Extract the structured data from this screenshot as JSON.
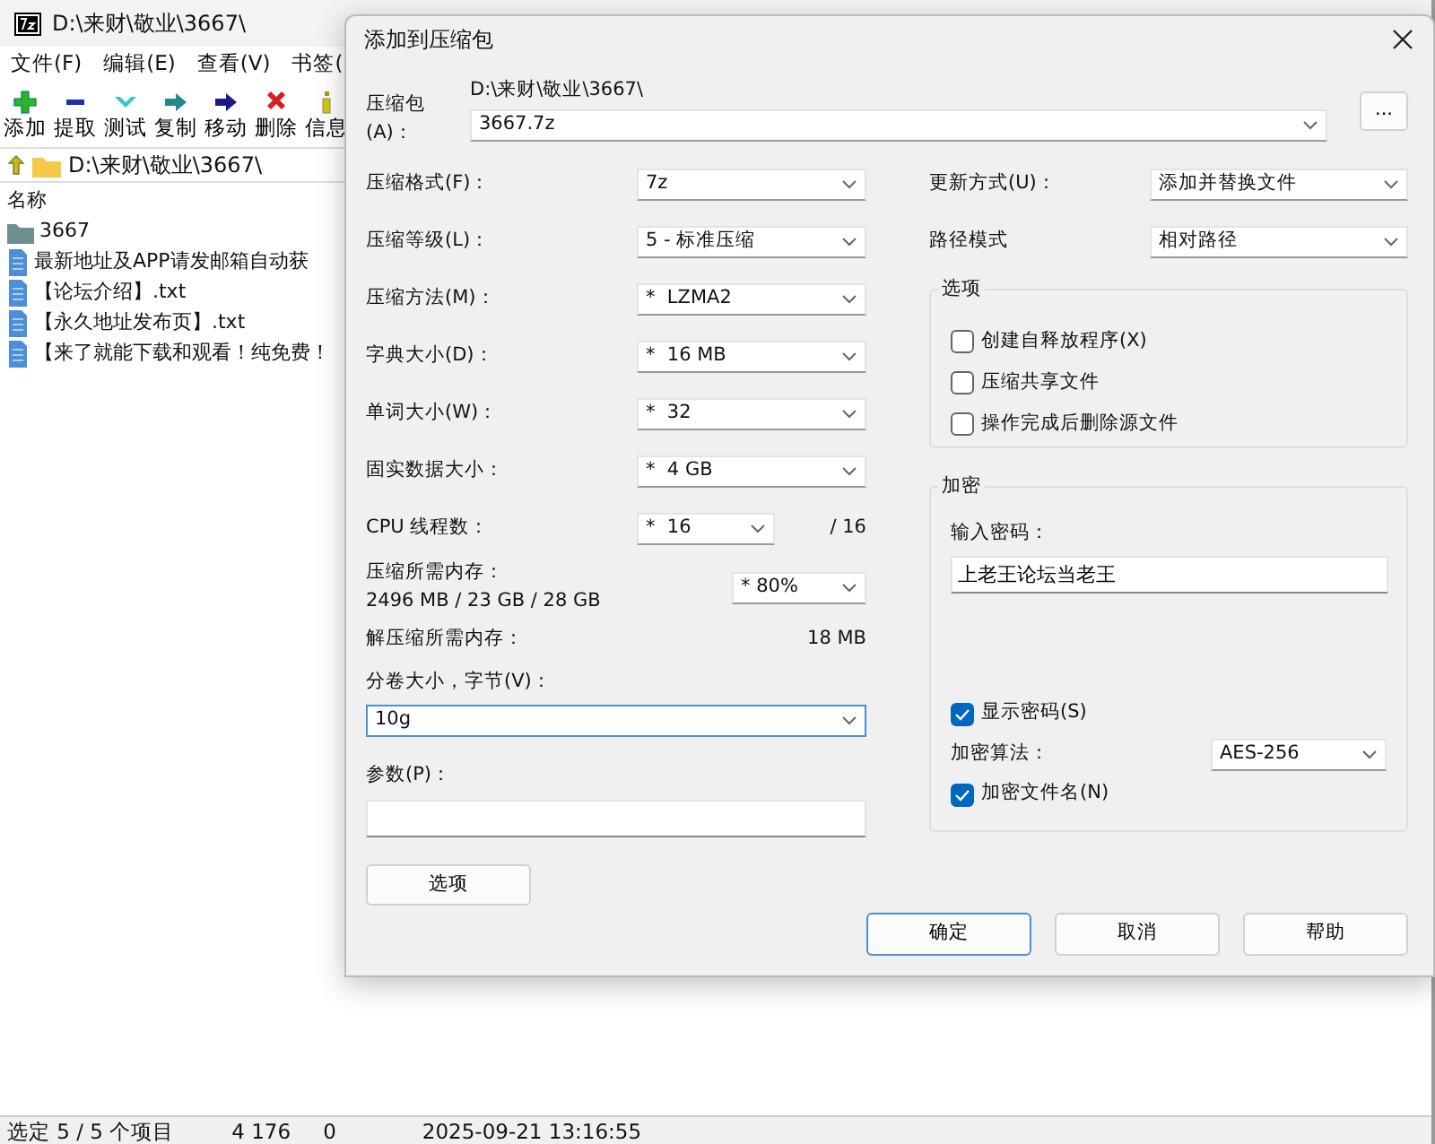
{
  "main_window": {
    "title": "D:\\来财\\敬业\\3667\\",
    "menu": [
      "文件(F)",
      "编辑(E)",
      "查看(V)",
      "书签("
    ],
    "toolbar": [
      {
        "kind": "add",
        "label": "添加"
      },
      {
        "kind": "extract",
        "label": "提取"
      },
      {
        "kind": "test",
        "label": "测试"
      },
      {
        "kind": "copy",
        "label": "复制"
      },
      {
        "kind": "move",
        "label": "移动"
      },
      {
        "kind": "delete",
        "label": "删除"
      },
      {
        "kind": "info",
        "label": "信息"
      }
    ],
    "address": "D:\\来财\\敬业\\3667\\",
    "list": {
      "column_1": "名称",
      "rows": [
        {
          "kind": "folder",
          "name": "3667"
        },
        {
          "kind": "file",
          "name": "最新地址及APP请发邮箱自动获"
        },
        {
          "kind": "file",
          "name": "【论坛介绍】.txt"
        },
        {
          "kind": "file",
          "name": "【永久地址发布页】.txt"
        },
        {
          "kind": "file",
          "name": "【来了就能下载和观看！纯免费！"
        }
      ]
    },
    "status_bar": [
      "选定 5 / 5 个项目",
      "4 176",
      "0",
      "2025-09-21 13:16:55"
    ]
  },
  "dialog": {
    "title": "添加到压缩包",
    "archive": {
      "label": "压缩包(A)：",
      "folder": "D:\\来财\\敬业\\3667\\",
      "value": "3667.7z",
      "browse": "..."
    },
    "left_rows": [
      {
        "kind": "combo",
        "label": "压缩格式(F)：",
        "value": "7z"
      },
      {
        "kind": "combo",
        "label": "压缩等级(L)：",
        "value": "5 - 标准压缩"
      },
      {
        "kind": "combo",
        "label": "压缩方法(M)：",
        "value": "*  LZMA2"
      },
      {
        "kind": "combo",
        "label": "字典大小(D)：",
        "value": "*  16 MB"
      },
      {
        "kind": "combo",
        "label": "单词大小(W)：",
        "value": "*  32"
      },
      {
        "kind": "combo",
        "label": "固实数据大小：",
        "value": "*  4 GB"
      },
      {
        "kind": "threads",
        "label": "CPU 线程数：",
        "value": "*  16",
        "suffix": "/ 16"
      },
      {
        "kind": "memory",
        "label": "压缩所需内存：",
        "detail": "2496 MB / 23 GB / 28 GB",
        "value": "* 80%"
      },
      {
        "kind": "info",
        "label": "解压缩所需内存：",
        "value": "18 MB"
      },
      {
        "kind": "wide_combo",
        "label": "分卷大小，字节(V)：",
        "value": "10g",
        "focused": true
      },
      {
        "kind": "wide_input",
        "label": "参数(P)："
      }
    ],
    "options_button": "选项",
    "right_rows": [
      {
        "label": "更新方式(U)：",
        "value": "添加并替换文件"
      },
      {
        "label": "路径模式",
        "value": "相对路径"
      }
    ],
    "options_group": {
      "title": "选项",
      "items": [
        {
          "label": "创建自释放程序(X)",
          "checked": false
        },
        {
          "label": "压缩共享文件",
          "checked": false
        },
        {
          "label": "操作完成后删除源文件",
          "checked": false
        }
      ]
    },
    "encryption": {
      "title": "加密",
      "password_label": "输入密码：",
      "password": "上老王论坛当老王",
      "show_password": {
        "label": "显示密码(S)",
        "checked": true
      },
      "method_label": "加密算法：",
      "method": "AES-256",
      "encrypt_names": {
        "label": "加密文件名(N)",
        "checked": true
      }
    },
    "buttons": [
      {
        "label": "确定",
        "default": true
      },
      {
        "label": "取消",
        "default": false
      },
      {
        "label": "帮助",
        "default": false
      }
    ]
  }
}
